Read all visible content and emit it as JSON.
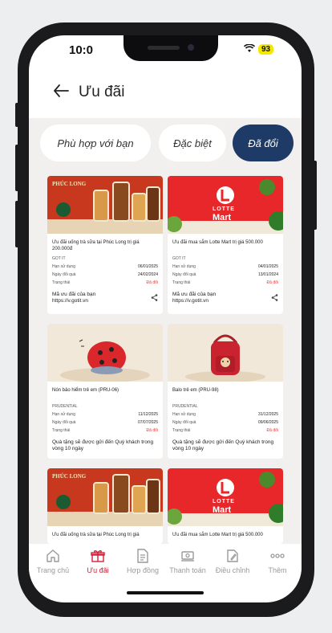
{
  "status_bar": {
    "time": "10:0",
    "battery": "93",
    "wifi_icon": "wifi-icon"
  },
  "header": {
    "title": "Ưu đãi",
    "back_icon": "arrow-left-icon"
  },
  "tabs": [
    {
      "label": "Phù hợp với bạn",
      "active": false
    },
    {
      "label": "Đặc biệt",
      "active": false
    },
    {
      "label": "Đã đổi",
      "active": true
    }
  ],
  "cards": [
    {
      "banner": {
        "type": "phuclong",
        "brand": "PHÚC LONG"
      },
      "title": "Ưu đãi uống trà sữa tại Phúc Long trị giá 200.000đ",
      "issuer": "GOT IT",
      "rows": [
        {
          "label": "Hạn sử dụng",
          "value": "06/01/2025"
        },
        {
          "label": "Ngày đổi quà",
          "value": "24/02/2024"
        },
        {
          "label": "Trạng thái",
          "value": "Đã đổi"
        }
      ],
      "footer": "Mã ưu đãi của bạn",
      "footer_link": "https://v.gotit.vn"
    },
    {
      "banner": {
        "type": "lotte",
        "brand_line1": "LOTTE",
        "brand_line2": "Mart"
      },
      "title": "Ưu đãi mua sắm Lotte Mart trị giá 500.000",
      "issuer": "GOT IT",
      "rows": [
        {
          "label": "Hạn sử dụng",
          "value": "04/01/2025"
        },
        {
          "label": "Ngày đổi quà",
          "value": "13/01/2024"
        },
        {
          "label": "Trạng thái",
          "value": "Đã đổi"
        }
      ],
      "footer": "Mã ưu đãi của bạn",
      "footer_link": "https://v.gotit.vn"
    },
    {
      "banner": {
        "type": "ladybug"
      },
      "title": "Nón bảo hiểm trẻ em (PRU-06)",
      "issuer": "PRUDENTIAL",
      "rows": [
        {
          "label": "Hạn sử dụng",
          "value": "11/12/2025"
        },
        {
          "label": "Ngày đổi quà",
          "value": "07/07/2025"
        },
        {
          "label": "Trạng thái",
          "value": "Đã đổi"
        }
      ],
      "footer": "Quà tặng sẽ được gửi đến Quý khách trong vòng 10 ngày",
      "footer_link": ""
    },
    {
      "banner": {
        "type": "backpack"
      },
      "title": "Balo trẻ em (PRU-98)",
      "issuer": "PRUDENTIAL",
      "rows": [
        {
          "label": "Hạn sử dụng",
          "value": "31/12/2025"
        },
        {
          "label": "Ngày đổi quà",
          "value": "09/06/2025"
        },
        {
          "label": "Trạng thái",
          "value": "Đã đổi"
        }
      ],
      "footer": "Quà tặng sẽ được gửi đến Quý khách trong vòng 10 ngày",
      "footer_link": ""
    },
    {
      "banner": {
        "type": "phuclong",
        "brand": "PHÚC LONG"
      },
      "title": "Ưu đãi uống trà sữa tại Phúc Long trị giá",
      "issuer": "",
      "rows": [],
      "footer": "",
      "footer_link": ""
    },
    {
      "banner": {
        "type": "lotte",
        "brand_line1": "LOTTE",
        "brand_line2": "Mart"
      },
      "title": "Ưu đãi mua sắm Lotte Mart trị giá 500.000",
      "issuer": "",
      "rows": [],
      "footer": "",
      "footer_link": ""
    }
  ],
  "nav": [
    {
      "label": "Trang chủ",
      "icon": "home-icon",
      "active": false
    },
    {
      "label": "Ưu đãi",
      "icon": "gift-icon",
      "active": true
    },
    {
      "label": "Hợp đồng",
      "icon": "document-icon",
      "active": false
    },
    {
      "label": "Thanh toán",
      "icon": "payment-icon",
      "active": false
    },
    {
      "label": "Điều chỉnh",
      "icon": "edit-icon",
      "active": false
    },
    {
      "label": "Thêm",
      "icon": "more-icon",
      "active": false
    }
  ],
  "colors": {
    "accent": "#d0223b",
    "tab_active": "#1e3a66",
    "status_red": "#e53935",
    "lotte_red": "#e8272a"
  }
}
